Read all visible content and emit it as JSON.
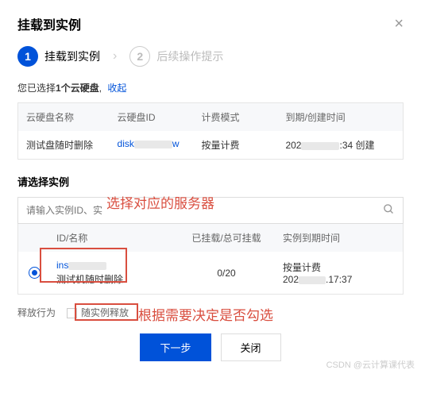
{
  "modal": {
    "title": "挂载到实例"
  },
  "steps": {
    "s1_num": "1",
    "s1_label": "挂载到实例",
    "s2_num": "2",
    "s2_label": "后续操作提示"
  },
  "summary": {
    "prefix": "您已选择",
    "count": "1个云硬盘",
    "collapse": "收起"
  },
  "disk_table": {
    "headers": {
      "name": "云硬盘名称",
      "id": "云硬盘ID",
      "billing": "计费模式",
      "time": "到期/创建时间"
    },
    "row": {
      "name": "测试盘随时删除",
      "id_prefix": "disk",
      "billing": "按量计费",
      "time_prefix": "202",
      "time_suffix": ":34 创建"
    }
  },
  "instance_section": {
    "title": "请选择实例",
    "search_placeholder": "请输入实例ID、实",
    "headers": {
      "id": "ID/名称",
      "mount": "已挂载/总可挂载",
      "expire": "实例到期时间"
    },
    "row": {
      "id_prefix": "ins",
      "name": "测试机随时删除",
      "mount": "0/20",
      "billing": "按量计费",
      "expire_prefix": "202",
      "expire_suffix": ".17:37"
    }
  },
  "release": {
    "label": "释放行为",
    "checkbox_label": "随实例释放"
  },
  "footer": {
    "next": "下一步",
    "close": "关闭"
  },
  "annotations": {
    "a1": "选择对应的服务器",
    "a2": "根据需要决定是否勾选"
  },
  "watermark": "CSDN @云计算课代表"
}
